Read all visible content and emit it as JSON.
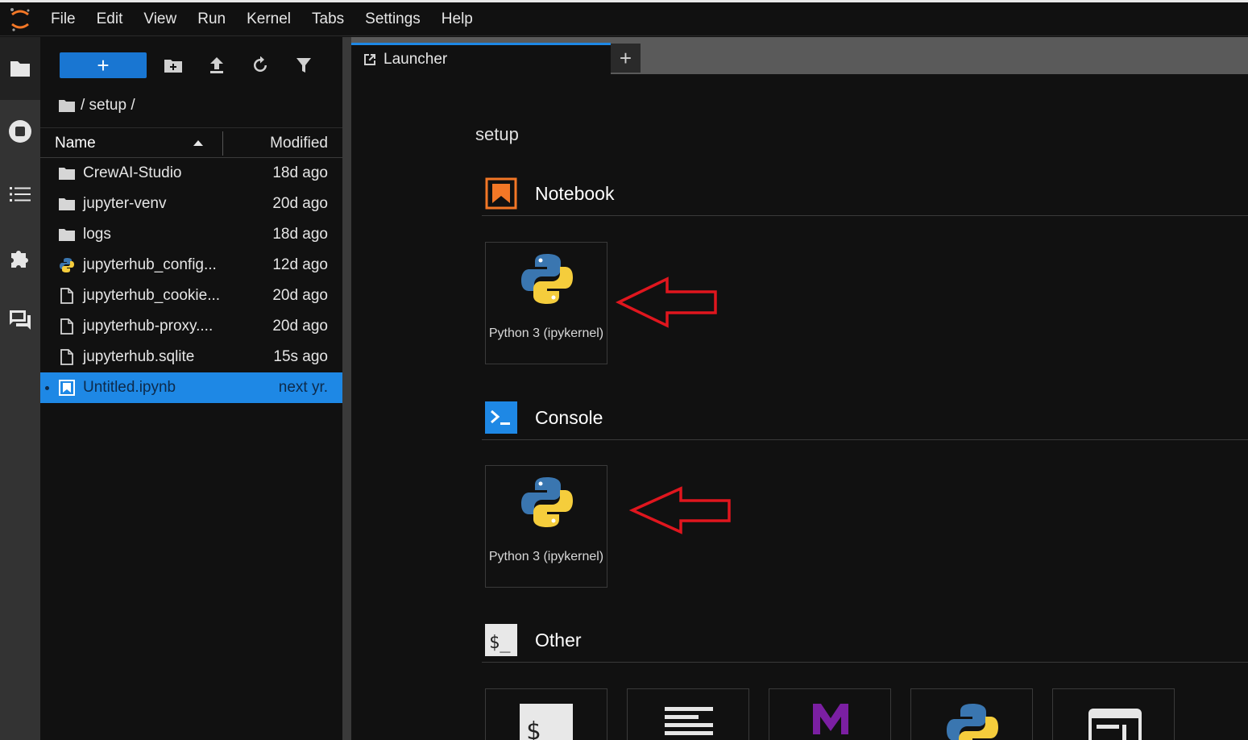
{
  "menubar": {
    "items": [
      "File",
      "Edit",
      "View",
      "Run",
      "Kernel",
      "Tabs",
      "Settings",
      "Help"
    ]
  },
  "activitybar": {
    "icons": [
      "folder-icon",
      "running-icon",
      "toc-icon",
      "extension-icon",
      "chat-icon"
    ]
  },
  "filebrowser": {
    "new_label": "+",
    "breadcrumb": "/ setup /",
    "header": {
      "name": "Name",
      "modified": "Modified"
    },
    "files": [
      {
        "name": "CrewAI-Studio",
        "modified": "18d ago",
        "icon": "folder-icon"
      },
      {
        "name": "jupyter-venv",
        "modified": "20d ago",
        "icon": "folder-icon"
      },
      {
        "name": "logs",
        "modified": "18d ago",
        "icon": "folder-icon"
      },
      {
        "name": "jupyterhub_config...",
        "modified": "12d ago",
        "icon": "python-file-icon"
      },
      {
        "name": "jupyterhub_cookie...",
        "modified": "20d ago",
        "icon": "file-icon"
      },
      {
        "name": "jupyterhub-proxy....",
        "modified": "20d ago",
        "icon": "file-icon"
      },
      {
        "name": "jupyterhub.sqlite",
        "modified": "15s ago",
        "icon": "file-icon"
      },
      {
        "name": "Untitled.ipynb",
        "modified": "next yr.",
        "icon": "notebook-file-icon"
      }
    ]
  },
  "tabs": [
    {
      "label": "Launcher"
    }
  ],
  "add_tab_label": "+",
  "launcher": {
    "cwd": "setup",
    "sections": {
      "notebook": {
        "title": "Notebook",
        "cards": [
          {
            "label": "Python 3 (ipykernel)"
          }
        ]
      },
      "console": {
        "title": "Console",
        "cards": [
          {
            "label": "Python 3 (ipykernel)"
          }
        ]
      },
      "other": {
        "title": "Other"
      }
    }
  },
  "colors": {
    "accent": "#1e88e5",
    "new_button": "#1976d2",
    "annotation_arrow": "#e0161e",
    "notebook_icon": "#f37726"
  }
}
